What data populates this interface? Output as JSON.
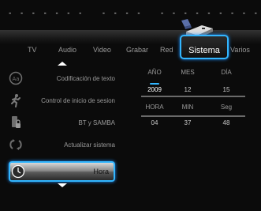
{
  "header": {
    "dash_text": "- - - - - - -   - - - -   - - - - - - - - -"
  },
  "menu": {
    "items": [
      {
        "label": "TV"
      },
      {
        "label": "Audio"
      },
      {
        "label": "Video"
      },
      {
        "label": "Grabar"
      },
      {
        "label": "Red"
      },
      {
        "label": "Sistema"
      },
      {
        "label": "Varios"
      }
    ],
    "active_index": 5
  },
  "settings_list": {
    "items": [
      {
        "label": "Codificación de texto",
        "icon": "text-encoding-icon"
      },
      {
        "label": "Control de inicio de sesion",
        "icon": "running-man-icon"
      },
      {
        "label": "BT y SAMBA",
        "icon": "device-lock-icon"
      },
      {
        "label": "Actualizar sistema",
        "icon": "refresh-icon"
      },
      {
        "label": "Hora",
        "icon": "clock-icon"
      }
    ],
    "selected_index": 4
  },
  "time_settings": {
    "date_headers": [
      "AÑO",
      "MES",
      "DÍA"
    ],
    "date_values": [
      "2009",
      "12",
      "15"
    ],
    "time_headers": [
      "HORA",
      "MIN",
      "Seg"
    ],
    "time_values": [
      "04",
      "37",
      "48"
    ]
  },
  "colors": {
    "accent": "#32b6ff",
    "background": "#0b0b0b"
  }
}
